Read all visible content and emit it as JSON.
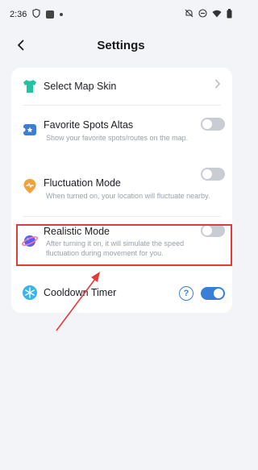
{
  "status_bar": {
    "time": "2:36"
  },
  "header": {
    "title": "Settings"
  },
  "items": [
    {
      "label": "Select Map Skin",
      "desc": "",
      "icon": "shirt-icon",
      "color": "#22c3a0"
    },
    {
      "label": "Favorite Spots Altas",
      "desc": "Show your favorite spots/routes on the map.",
      "icon": "ticket-icon",
      "color": "#3a7fd6",
      "toggle": false
    },
    {
      "label": "Fluctuation Mode",
      "desc": "When turned on, your location will fluctuate nearby.",
      "icon": "pin-icon",
      "color": "#f3a23a",
      "toggle": false
    },
    {
      "label": "Realistic Mode",
      "desc": "After turning it on, it will simulate the speed fluctuation during movement for you.",
      "icon": "planet-icon",
      "color": "#5b5fe3",
      "toggle": false
    },
    {
      "label": "Cooldown Timer",
      "desc": "",
      "icon": "snowflake-icon",
      "color": "#38b6e8",
      "toggle": true,
      "help": "?"
    }
  ],
  "colors": {
    "accent": "#3a7fd6",
    "highlight": "#e23b3b",
    "toggle_off": "#c8ccd3"
  }
}
